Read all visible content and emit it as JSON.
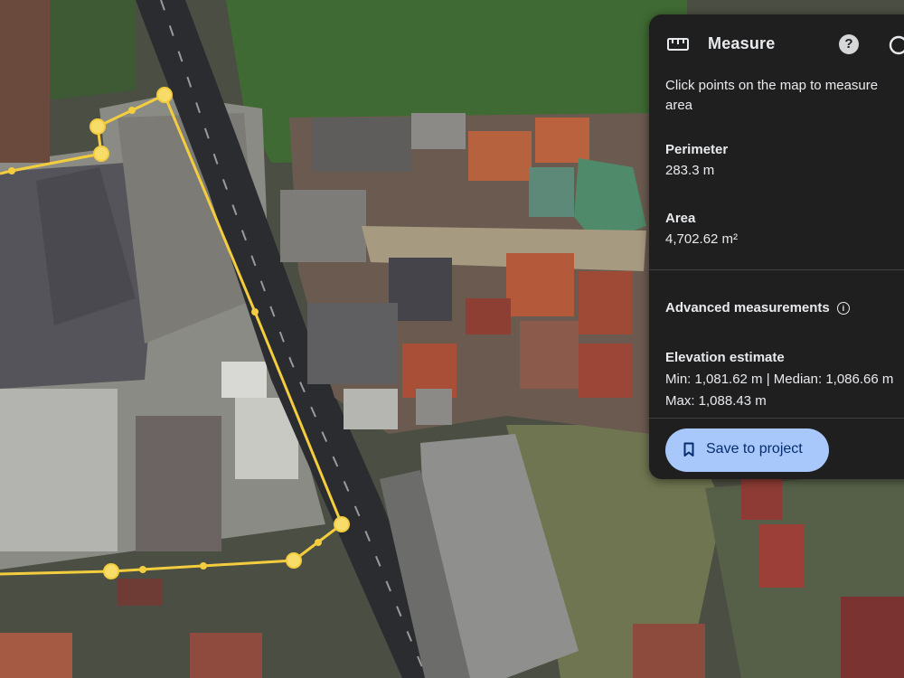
{
  "panel": {
    "title": "Measure",
    "help_glyph": "?",
    "instructions_line1": "Click points on the map to measure",
    "instructions_line2": "area",
    "perimeter_label": "Perimeter",
    "perimeter_value": "283.3 m",
    "area_label": "Area",
    "area_value": "4,702.62 m²",
    "advanced_label": "Advanced measurements",
    "info_glyph": "i",
    "elevation_label": "Elevation estimate",
    "elevation_min_median": "Min: 1,081.62 m | Median: 1,086.66 m",
    "elevation_max": "Max: 1,088.43 m",
    "save_label": "Save to project"
  },
  "icons": {
    "ruler": "ruler-icon",
    "help": "help-icon",
    "close": "close-icon",
    "info": "info-icon",
    "bookmark": "bookmark-icon"
  },
  "colors": {
    "panel_bg": "#1f1f1f",
    "panel_text": "#e8eaed",
    "save_button_bg": "#a8c7fa",
    "save_button_text": "#062e6f",
    "measure_line": "#f4cd3f",
    "road": "#2a2c30"
  }
}
